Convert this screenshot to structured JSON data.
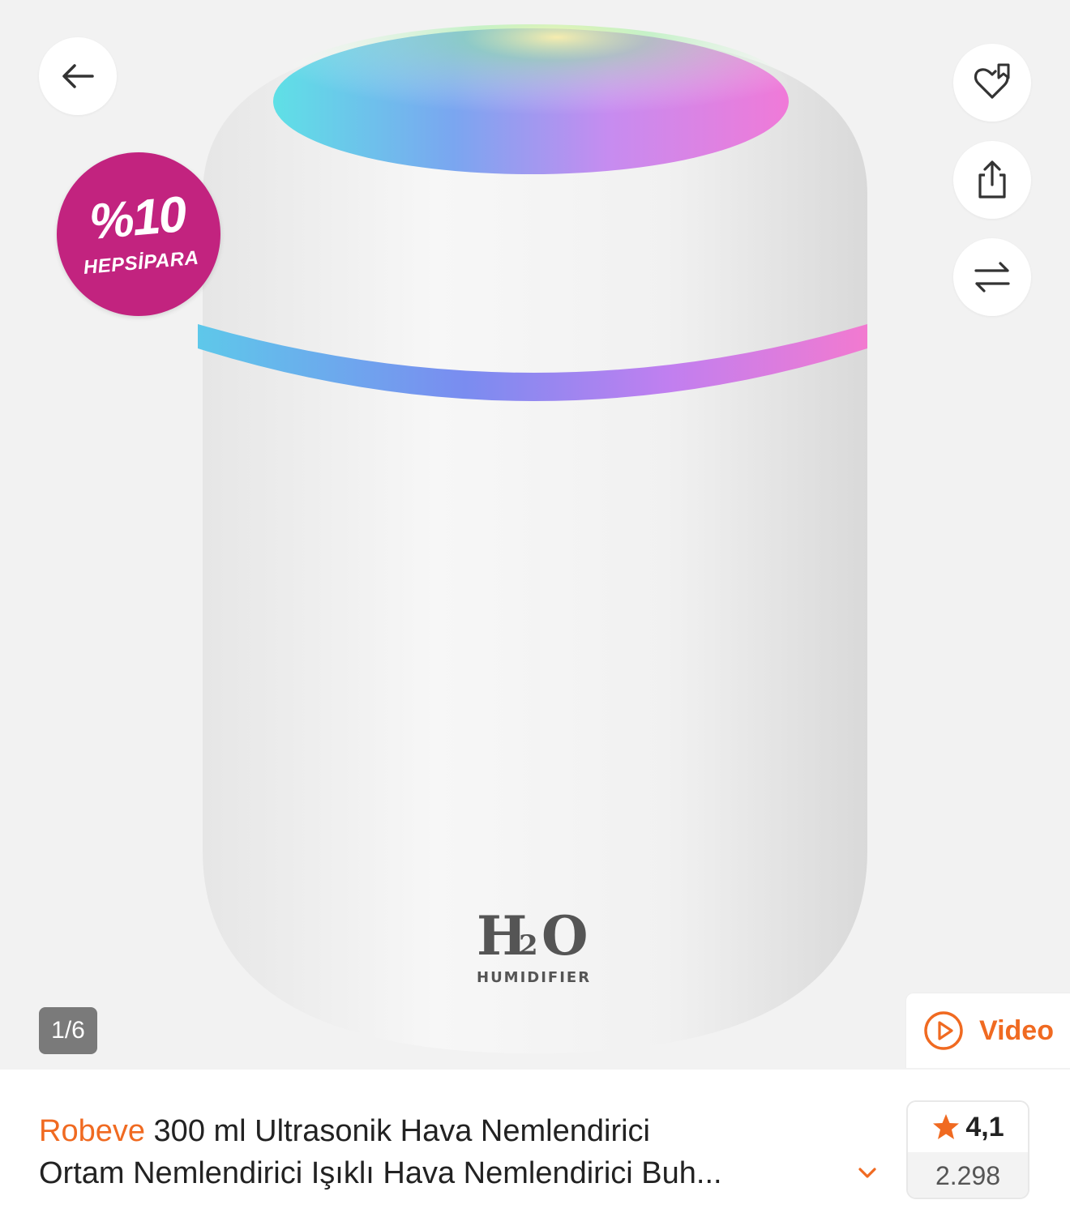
{
  "gallery": {
    "page_counter": "1/6",
    "video_label": "Video",
    "product_print": {
      "main": "H",
      "sub": "2",
      "end": "O",
      "caption": "HUMIDIFIER"
    }
  },
  "promo": {
    "percent": "%10",
    "label": "HEPSİPARA",
    "color": "#c2237f"
  },
  "product": {
    "brand": "Robeve",
    "title_line1": "300 ml Ultrasonik Hava Nemlendirici",
    "title_line2": "Ortam Nemlendirici Işıklı Hava Nemlendirici Buh...",
    "rating": "4,1",
    "review_count": "2.298"
  },
  "colors": {
    "accent": "#f06a21",
    "badge": "#c2237f"
  },
  "icons": [
    "back-arrow-icon",
    "heart-bookmark-icon",
    "share-icon",
    "compare-icon",
    "play-circle-icon",
    "chevron-down-icon",
    "star-icon"
  ]
}
